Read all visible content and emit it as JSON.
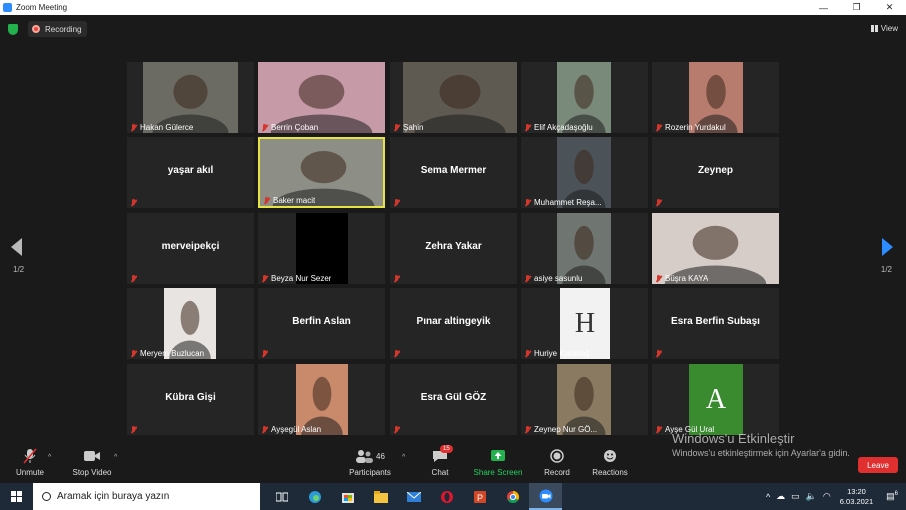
{
  "window": {
    "title": "Zoom Meeting",
    "min": "—",
    "max": "❐",
    "close": "✕"
  },
  "topbar": {
    "recording": "Recording",
    "view": "View"
  },
  "pager": {
    "left": "1/2",
    "right": "1/2"
  },
  "tiles": [
    {
      "name": "Hakan Gülerce",
      "video": true,
      "bg": "#6b6a63"
    },
    {
      "name": "Berrin Çoban",
      "video": true,
      "bg": "#c79aa8"
    },
    {
      "name": "Şahin",
      "video": true,
      "bg": "#5e5a52"
    },
    {
      "name": "Elif Akçadaşoğlu",
      "video": true,
      "bg": "#7a8a7a"
    },
    {
      "name": "Rozerin Yurdakul",
      "video": true,
      "bg": "#b87c6e"
    },
    {
      "name": "yaşar akıl",
      "big": "yaşar akıl"
    },
    {
      "name": "Baker macit",
      "video": true,
      "bg": "#8d8f86",
      "active": true
    },
    {
      "name": "Sema Mermer",
      "big": "Sema Mermer"
    },
    {
      "name": "Muhammet Reşa...",
      "video": true,
      "bg": "#4b5258"
    },
    {
      "name": "Zeynep",
      "big": "Zeynep"
    },
    {
      "name": "merveipekçi",
      "big": "merveipekçi"
    },
    {
      "name": "Beyza Nur Sezer",
      "video": true,
      "bg": "#000000"
    },
    {
      "name": "Zehra Yakar",
      "big": "Zehra Yakar"
    },
    {
      "name": "asiye sasunlu",
      "video": true,
      "bg": "#6f7570"
    },
    {
      "name": "Büşra KAYA",
      "video": true,
      "bg": "#d6cdc8"
    },
    {
      "name": "Meryem Buzlucan",
      "video": true,
      "bg": "#e8e4e2"
    },
    {
      "name": "Berfin Aslan",
      "big": "Berfin Aslan"
    },
    {
      "name": "Pınar altingeyik",
      "big": "Pınar altingeyik"
    },
    {
      "name": "Huriye Karadağ",
      "video": true,
      "bg": "#f2f2f2",
      "letter": "H"
    },
    {
      "name": "Esra Berfin Subaşı",
      "big": "Esra Berfin Subaşı"
    },
    {
      "name": "Kübra Gişi",
      "big": "Kübra Gişi"
    },
    {
      "name": "Ayşegül Aslan",
      "video": true,
      "bg": "#c98a6c"
    },
    {
      "name": "Esra Gül GÖZ",
      "big": "Esra Gül GÖZ"
    },
    {
      "name": "Zeynep Nur GÖ...",
      "video": true,
      "bg": "#8a7a62"
    },
    {
      "name": "Ayşe Gül Ural",
      "video": true,
      "bg": "#3a8a30",
      "letter": "A"
    }
  ],
  "toolbar": {
    "unmute": "Unmute",
    "stop_video": "Stop Video",
    "participants": "Participants",
    "participants_count": "46",
    "chat": "Chat",
    "chat_badge": "15",
    "share": "Share Screen",
    "record": "Record",
    "reactions": "Reactions",
    "leave": "Leave"
  },
  "watermark": {
    "line1": "Windows'u Etkinleştir",
    "line2": "Windows'u etkinleştirmek için Ayarlar'a gidin."
  },
  "taskbar": {
    "search_placeholder": "Aramak için buraya yazın",
    "time": "13:20",
    "date": "6.03.2021",
    "notif": "6"
  }
}
